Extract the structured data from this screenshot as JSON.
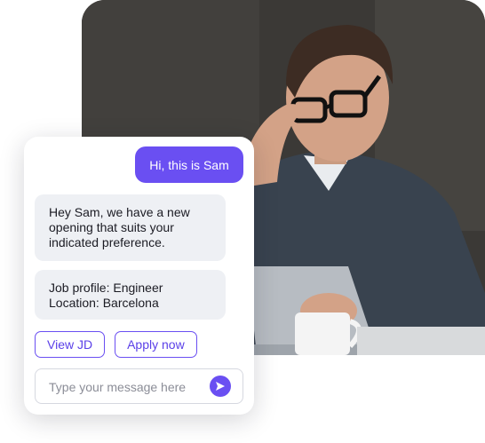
{
  "chat": {
    "user_message": "Hi, this is Sam",
    "bot_message_lines": [
      "Hey Sam, we have a new",
      "opening that suits your",
      "indicated preference."
    ],
    "job_details": [
      "Job profile: Engineer",
      "Location: Barcelona"
    ],
    "actions": {
      "view_jd": "View JD",
      "apply_now": "Apply now"
    },
    "input": {
      "placeholder": "Type your message here",
      "value": ""
    },
    "send_icon": "send-arrow-icon"
  },
  "colors": {
    "accent": "#6a4ff2",
    "bot_bubble": "#eef0f4",
    "card_background": "#ffffff"
  }
}
